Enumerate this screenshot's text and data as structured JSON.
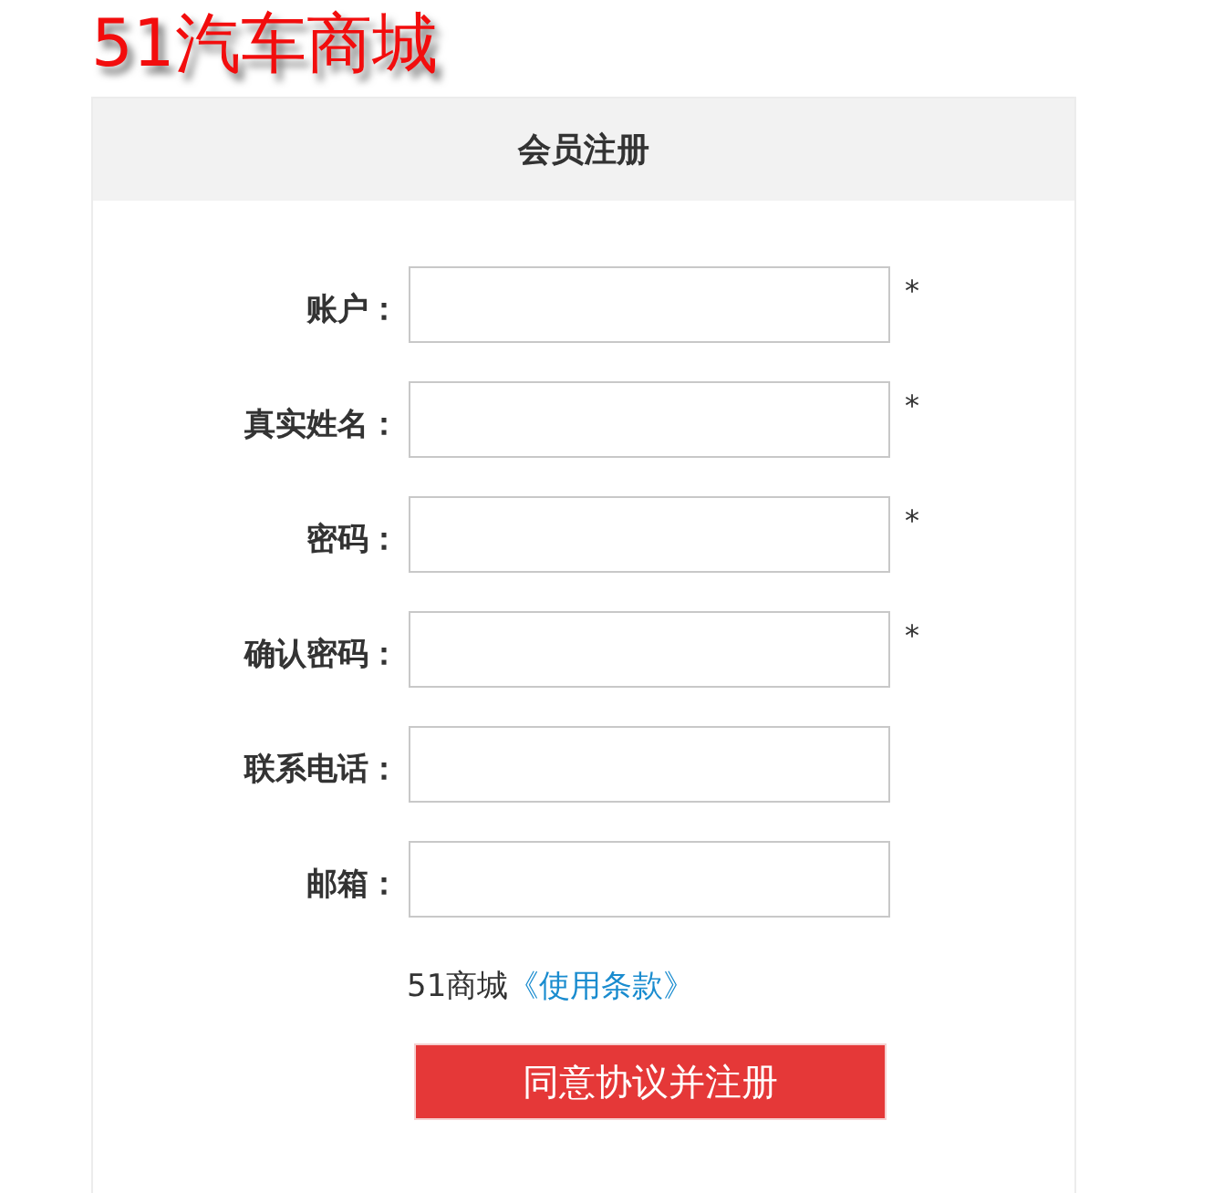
{
  "logo": "51汽车商城",
  "panel": {
    "title": "会员注册"
  },
  "fields": [
    {
      "label": "账户：",
      "required": true
    },
    {
      "label": "真实姓名：",
      "required": true
    },
    {
      "label": "密码：",
      "required": true
    },
    {
      "label": "确认密码：",
      "required": true
    },
    {
      "label": "联系电话：",
      "required": false
    },
    {
      "label": "邮箱：",
      "required": false
    }
  ],
  "required_mark": "*",
  "terms": {
    "text": "51商城",
    "link": "《使用条款》"
  },
  "submit": "同意协议并注册"
}
